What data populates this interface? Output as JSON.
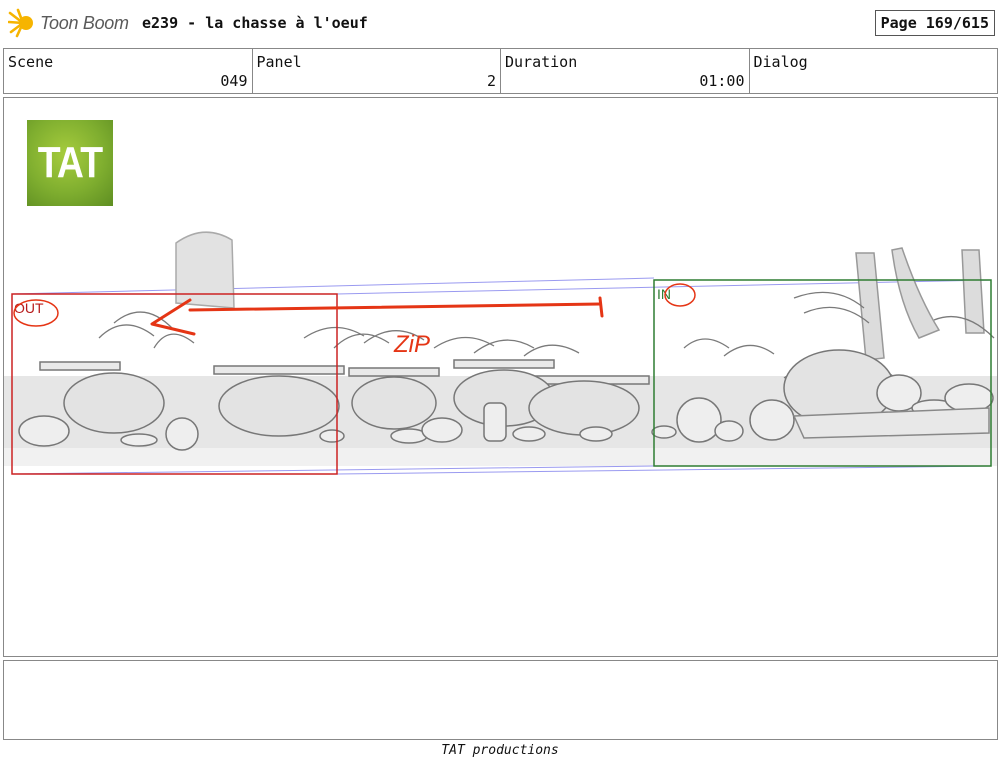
{
  "header": {
    "brand": "Toon Boom",
    "title": "e239 - la chasse à l'oeuf",
    "page_indicator": "Page 169/615"
  },
  "info": {
    "scene_label": "Scene",
    "scene_value": "049",
    "panel_label": "Panel",
    "panel_value": "2",
    "duration_label": "Duration",
    "duration_value": "01:00",
    "dialog_label": "Dialog"
  },
  "panel": {
    "logo_text": "TAT",
    "out_label": "OUT",
    "in_label": "IN",
    "zip_label": "ZiP",
    "colors": {
      "out_frame": "#cc2222",
      "in_frame": "#2e7d32",
      "arrow": "#e53515",
      "guide": "#9a9af0"
    }
  },
  "footer": {
    "text": "TAT productions"
  }
}
